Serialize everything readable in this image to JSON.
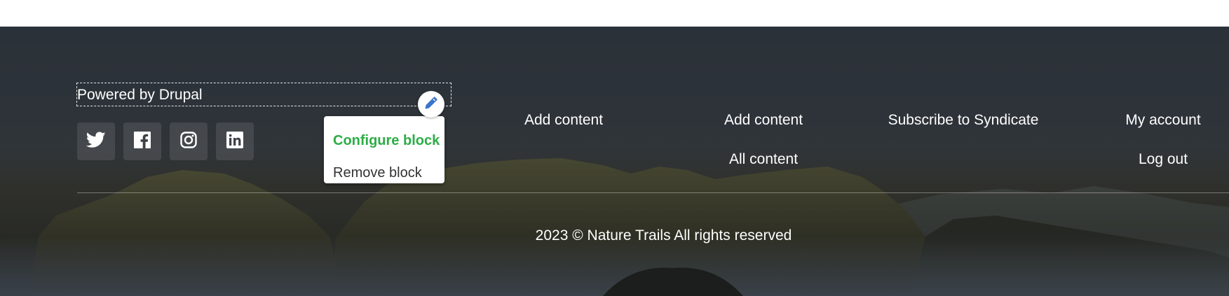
{
  "footer": {
    "powered_by": "Powered by Drupal",
    "contextual_menu": {
      "configure_label": "Configure block",
      "remove_label": "Remove block"
    },
    "social_icons": [
      "twitter-icon",
      "facebook-icon",
      "instagram-icon",
      "linkedin-icon"
    ],
    "menu_columns": [
      {
        "links": [
          "Add content"
        ]
      },
      {
        "links": [
          "Add content",
          "All content"
        ]
      },
      {
        "links": [
          "Subscribe to Syndicate"
        ]
      },
      {
        "links": [
          "My account",
          "Log out"
        ]
      }
    ],
    "copyright": "2023 © Nature Trails All rights reserved"
  },
  "colors": {
    "accent_green": "#2dad47",
    "pencil_blue": "#3c74c9",
    "text_light": "#ffffff"
  }
}
